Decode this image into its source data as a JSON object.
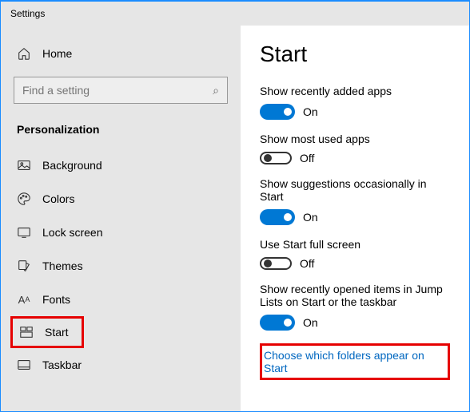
{
  "header": {
    "title": "Settings"
  },
  "sidebar": {
    "home": "Home",
    "search_placeholder": "Find a setting",
    "category": "Personalization",
    "items": [
      {
        "label": "Background"
      },
      {
        "label": "Colors"
      },
      {
        "label": "Lock screen"
      },
      {
        "label": "Themes"
      },
      {
        "label": "Fonts"
      },
      {
        "label": "Start"
      },
      {
        "label": "Taskbar"
      }
    ]
  },
  "main": {
    "title": "Start",
    "settings": [
      {
        "label": "Show recently added apps",
        "value": true,
        "state": "On"
      },
      {
        "label": "Show most used apps",
        "value": false,
        "state": "Off"
      },
      {
        "label": "Show suggestions occasionally in Start",
        "value": true,
        "state": "On"
      },
      {
        "label": "Use Start full screen",
        "value": false,
        "state": "Off"
      },
      {
        "label": "Show recently opened items in Jump Lists on Start or the taskbar",
        "value": true,
        "state": "On"
      }
    ],
    "link": "Choose which folders appear on Start"
  }
}
